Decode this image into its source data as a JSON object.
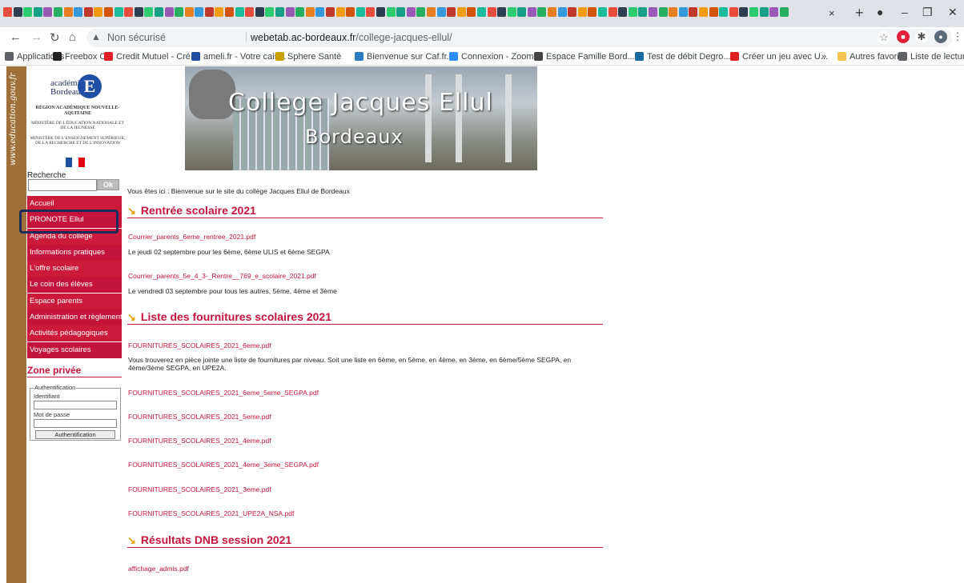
{
  "browser": {
    "tab_close": "×",
    "new_tab": "+",
    "address": {
      "security": "Non sécurisé",
      "separator": "|",
      "host": "webetab.ac-bordeaux.fr",
      "path": "/college-jacques-ellul/"
    },
    "bookmarks": [
      {
        "label": "Applications",
        "color": "#5f6368"
      },
      {
        "label": "Freebox OS",
        "color": "#222222"
      },
      {
        "label": "Credit Mutuel - Cré...",
        "color": "#e31e24"
      },
      {
        "label": "ameli.fr - Votre cais...",
        "color": "#1f4ea3"
      },
      {
        "label": "Sphere Santé",
        "color": "#c8a000"
      },
      {
        "label": "Bienvenue sur Caf.fr...",
        "color": "#2d7bc0"
      },
      {
        "label": "Connexion - Zoom",
        "color": "#2d8cff"
      },
      {
        "label": "Espace Famille Bord...",
        "color": "#444444"
      },
      {
        "label": "Test de débit Degro...",
        "color": "#1a6aa0"
      },
      {
        "label": "Créer un jeu avec U...",
        "color": "#e02020"
      }
    ],
    "bookmarks_overflow": "»",
    "bookmarks_right": [
      {
        "label": "Autres favoris",
        "color": "#f4c44e"
      },
      {
        "label": "Liste de lecture",
        "color": "#5f6368"
      }
    ]
  },
  "sidebar": {
    "vertical_text": "www.education.gouv.fr",
    "logo": {
      "academie": "académie",
      "bordeaux": "Bordeaux",
      "region": "RÉGION ACADÉMIQUE NOUVELLE-AQUITAINE",
      "ministere1": "MINISTÈRE DE L'ÉDUCATION NATIONALE ET DE LA JEUNESSE",
      "ministere2": "MINISTÈRE DE L'ENSEIGNEMENT SUPÉRIEUR, DE LA RECHERCHE ET DE L'INNOVATION"
    },
    "search_label": "Recherche",
    "search_button": "Ok",
    "menu": [
      "Accueil",
      "PRONOTE Ellul",
      "Agenda du collège",
      "Informations pratiques",
      "L'offre scolaire",
      "Le coin des élèves",
      "Espace parents",
      "Administration et règlements",
      "Activités pédagogiques",
      "Voyages scolaires"
    ],
    "zone_title": "Zone privée",
    "auth": {
      "legend": "Authentification",
      "id_label": "Identifiant",
      "pw_label": "Mot de passe",
      "button": "Authentification"
    }
  },
  "banner": {
    "line1": "College Jacques Ellul",
    "line2": "Bordeaux"
  },
  "content": {
    "breadcrumb": "Vous êtes ici : Bienvenue sur le site du collège Jacques Ellul de Bordeaux",
    "sections": [
      {
        "title": "Rentrée scolaire 2021"
      },
      {
        "title": "Liste des fournitures scolaires 2021"
      },
      {
        "title": "Résultats DNB session 2021"
      }
    ],
    "items": {
      "rentree_link1": "Courrier_parents_6eme_rentree_2021.pdf",
      "rentree_text1": "Le jeudi 02 septembre pour les 6ème, 6ème ULIS et 6ème SEGPA",
      "rentree_link2": "Courrier_parents_5e_4_3-_Rentre__769_e_scolaire_2021.pdf",
      "rentree_text2": "Le vendredi 03 septembre pour tous les autres, 5ème, 4ème et 3ème",
      "fourn_link1": "FOURNITURES_SCOLAIRES_2021_6eme.pdf",
      "fourn_text1": "Vous trouverez en pièce jointe une liste de fournitures par niveau. Soit une liste en 6ème, en 5ème, en 4ème, en 3ème, en 6ème/5ème SEGPA, en 4ème/3ème SEGPA, en UPE2A.",
      "fourn_link2": "FOURNITURES_SCOLAIRES_2021_6eme_5eme_SEGPA.pdf",
      "fourn_link3": "FOURNITURES_SCOLAIRES_2021_5eme.pdf",
      "fourn_link4": "FOURNITURES_SCOLAIRES_2021_4eme.pdf",
      "fourn_link5": "FOURNITURES_SCOLAIRES_2021_4eme_3eme_SEGPA.pdf",
      "fourn_link6": "FOURNITURES_SCOLAIRES_2021_3eme.pdf",
      "fourn_link7": "FOURNITURES_SCOLAIRES_2021_UPE2A_NSA.pdf",
      "dnb_link1": "affichage_admis.pdf"
    }
  },
  "colors": {
    "accent": "#c4143b",
    "chevron": "#e5a000",
    "sidebar_brown": "#a0703a",
    "highlight_box": "#1a2a5a"
  }
}
